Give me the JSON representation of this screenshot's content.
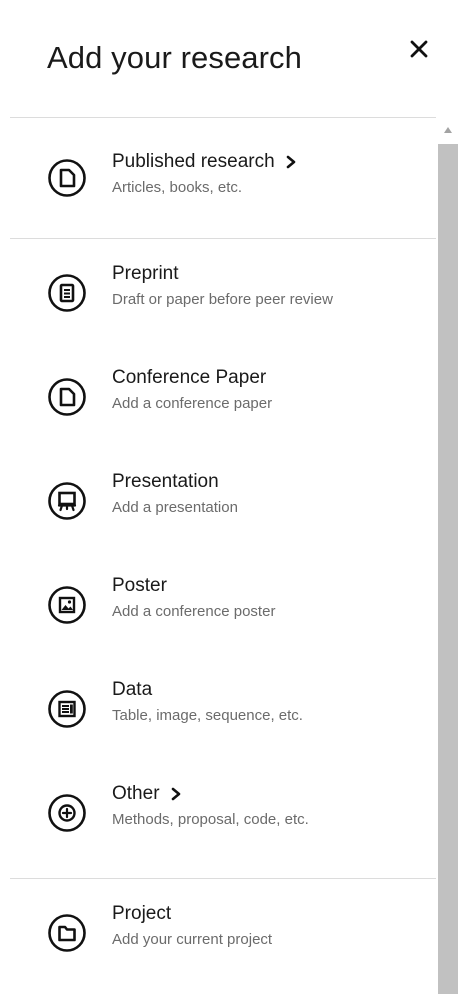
{
  "header": {
    "title": "Add your research",
    "close_symbol": "✕"
  },
  "items": [
    {
      "label": "Published research",
      "sub": "Articles, books, etc.",
      "icon": "document-icon",
      "chevron": true
    },
    {
      "label": "Preprint",
      "sub": "Draft or paper before peer review",
      "icon": "clipboard-icon",
      "chevron": false
    },
    {
      "label": "Conference Paper",
      "sub": "Add a conference paper",
      "icon": "document-icon",
      "chevron": false
    },
    {
      "label": "Presentation",
      "sub": "Add a presentation",
      "icon": "presentation-board-icon",
      "chevron": false
    },
    {
      "label": "Poster",
      "sub": "Add a conference poster",
      "icon": "image-icon",
      "chevron": false
    },
    {
      "label": "Data",
      "sub": "Table, image, sequence, etc.",
      "icon": "data-list-icon",
      "chevron": false
    },
    {
      "label": "Other",
      "sub": "Methods, proposal, code, etc.",
      "icon": "plus-circle-icon",
      "chevron": true
    },
    {
      "label": "Project",
      "sub": "Add your current project",
      "icon": "folder-icon",
      "chevron": false
    }
  ],
  "colors": {
    "text": "#1a1a1a",
    "subtext": "#6b6b6b",
    "divider": "#dcdcdc",
    "scroll_thumb": "#c1c1c1"
  }
}
